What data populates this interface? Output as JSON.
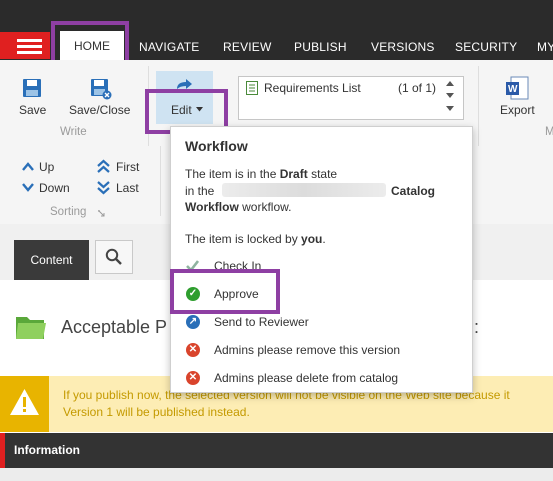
{
  "tabs": [
    "HOME",
    "NAVIGATE",
    "REVIEW",
    "PUBLISH",
    "VERSIONS",
    "SECURITY",
    "MY"
  ],
  "ribbon": {
    "save": "Save",
    "save_close": "Save/Close",
    "write_group": "Write",
    "edit": "Edit",
    "export": "Export",
    "export_group_partial": "M",
    "up": "Up",
    "down": "Down",
    "first": "First",
    "last": "Last",
    "sorting_group": "Sorting",
    "requirements_list": "Requirements List",
    "requirements_count": "(1 of 1)"
  },
  "content": {
    "content_tab": "Content",
    "item_title_start": "Acceptable P",
    "item_title_end": "g:"
  },
  "warning": {
    "line1": "If you publish now, the selected version will not be visible on the Web site because it",
    "line2": "Version 1 will be published instead."
  },
  "info": {
    "title": "Information"
  },
  "workflow_menu": {
    "title": "Workflow",
    "state_prefix": "The item is in the ",
    "state_name": "Draft",
    "state_suffix": " state",
    "in_prefix": "in the",
    "workflow_name_part1": "Catalog",
    "workflow_name_part2": "Workflow",
    "workflow_suffix": " workflow.",
    "locked_prefix": "The item is locked by ",
    "locked_by": "you",
    "locked_suffix": ".",
    "items": [
      {
        "label": "Check In",
        "icon": "checkmark-icon",
        "color": "#8fb3a0"
      },
      {
        "label": "Approve",
        "icon": "check-circle-icon",
        "color": "#2e9e2e"
      },
      {
        "label": "Send to Reviewer",
        "icon": "send-circle-icon",
        "color": "#2a6fb8"
      },
      {
        "label": "Admins please remove this version",
        "icon": "x-circle-icon",
        "color": "#d9442c"
      },
      {
        "label": "Admins please delete from catalog",
        "icon": "x-circle-icon",
        "color": "#d9442c"
      }
    ]
  },
  "colors": {
    "accent_red": "#e02020",
    "highlight_purple": "#8e3fa3",
    "edit_blue": "#cfe3f2",
    "warning_bg": "#fdedb4"
  }
}
